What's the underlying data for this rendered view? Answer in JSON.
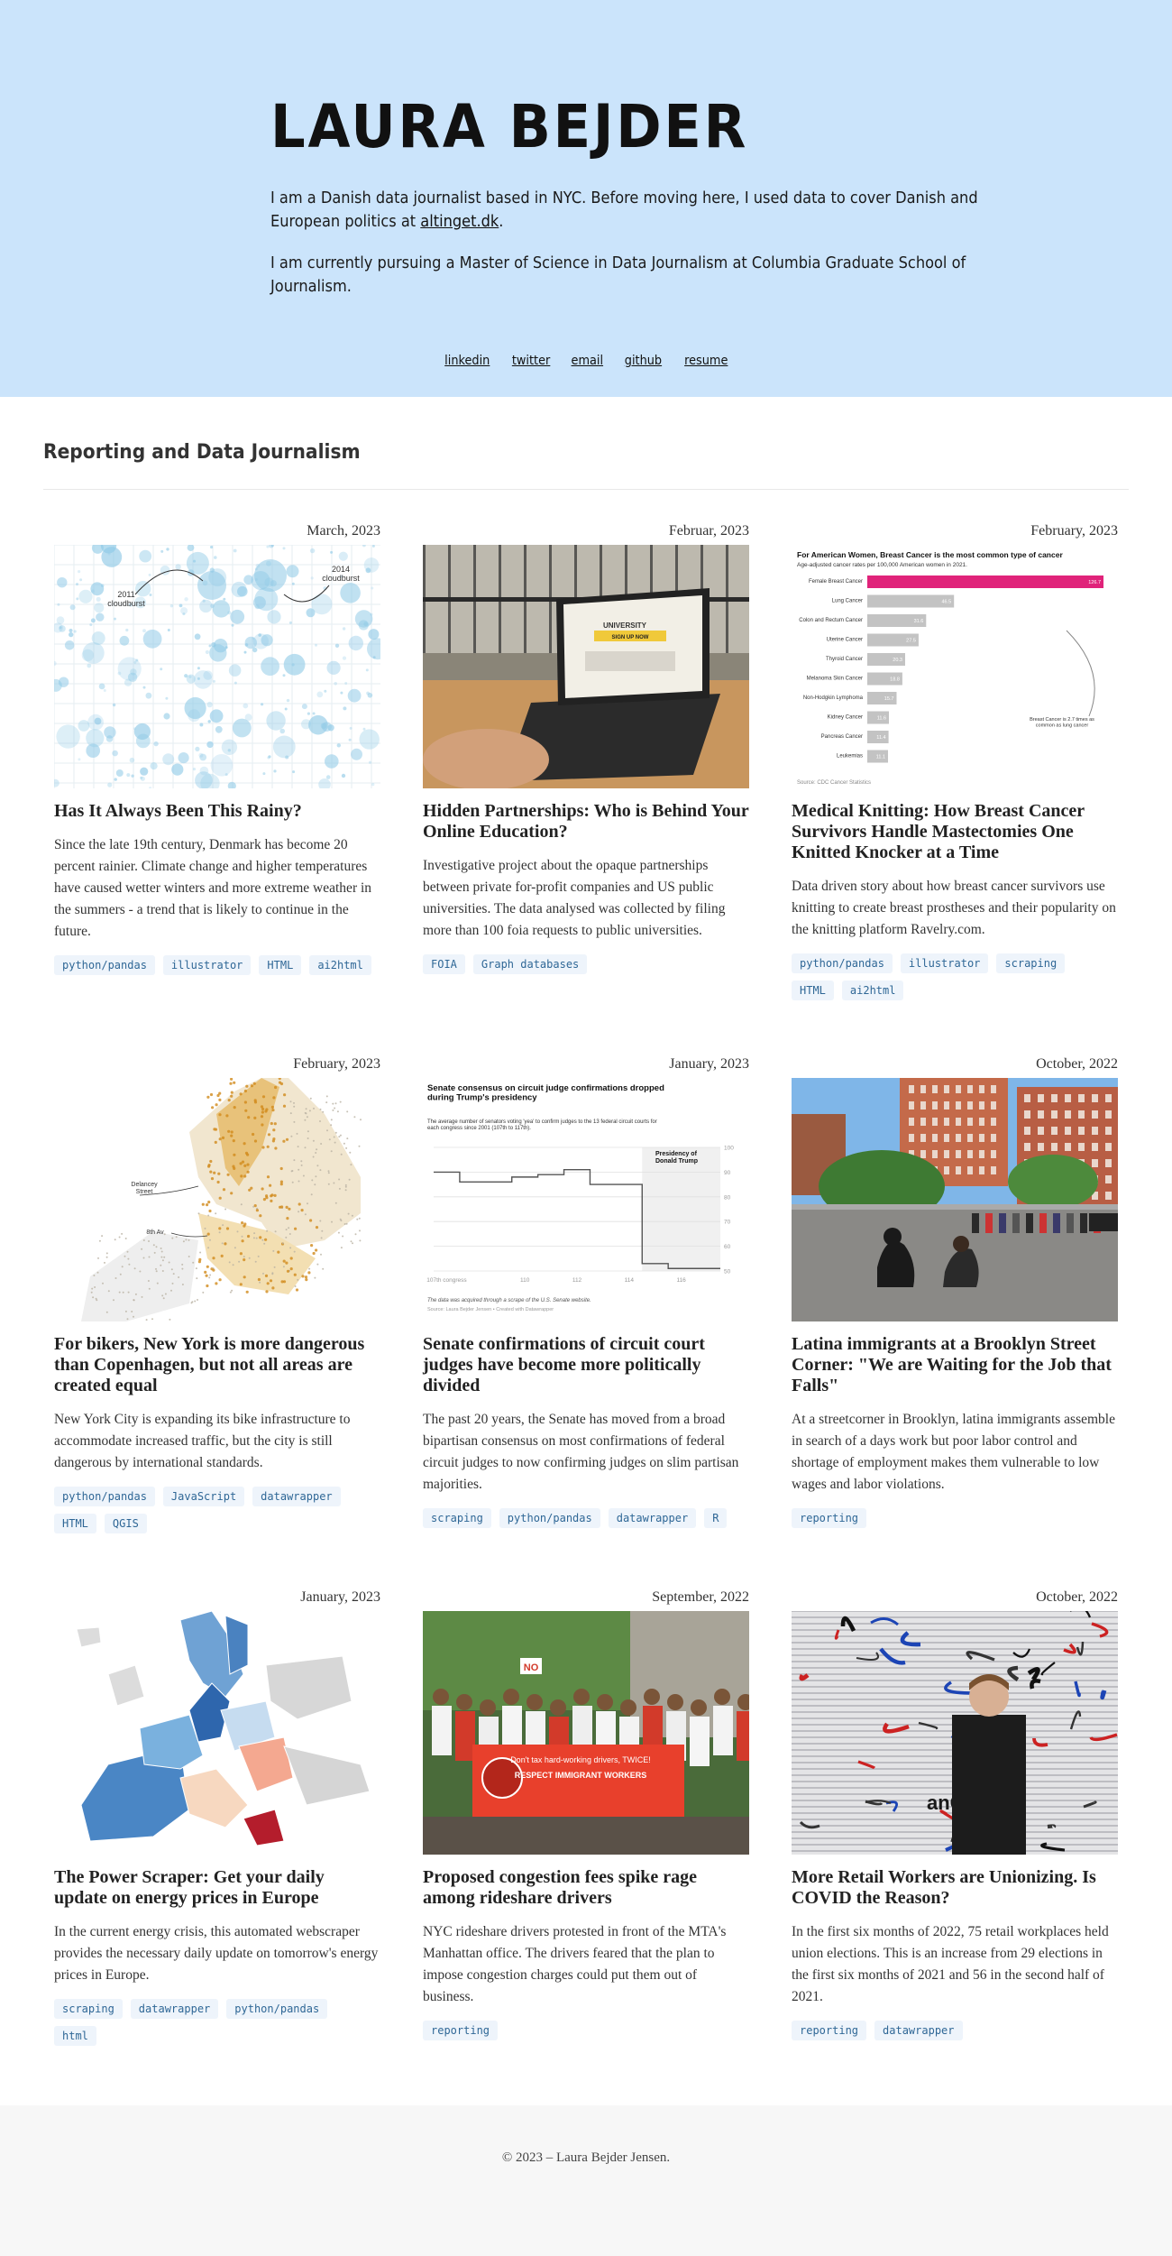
{
  "hero": {
    "name": "LAURA BEJDER",
    "bio1_prefix": "I am a Danish data journalist based in NYC. Before moving here, I used data to cover Danish and European politics at ",
    "bio1_link": "altinget.dk",
    "bio1_suffix": ".",
    "bio2": "I am currently pursuing a Master of Science in Data Journalism at Columbia Graduate School of Journalism."
  },
  "social": [
    "linkedin",
    "twitter",
    "email",
    "github",
    "resume"
  ],
  "section_title": "Reporting and Data Journalism",
  "cards": [
    {
      "date": "March, 2023",
      "title": "Has It Always Been This Rainy?",
      "desc": "Since the late 19th century, Denmark has become 20 percent rainier. Climate change and higher temperatures have caused wetter winters and more extreme weather in the summers - a trend that is likely to continue in the future.",
      "tags": [
        "python/pandas",
        "illustrator",
        "HTML",
        "ai2html"
      ],
      "thumb": "rain",
      "labels": [
        "2011\ncloudburst",
        "2014\ncloudburst"
      ]
    },
    {
      "date": "Februar, 2023",
      "title": "Hidden Partnerships: Who is Behind Your Online Education?",
      "desc": "Investigative project about the opaque partnerships between private for-profit companies and US public universities. The data analysed was collected by filing more than 100 foia requests to public universities.",
      "tags": [
        "FOIA",
        "Graph databases"
      ],
      "thumb": "laptop",
      "labels": [
        "UNIVERSITY",
        "SIGN UP NOW"
      ]
    },
    {
      "date": "February, 2023",
      "title": "Medical Knitting: How Breast Cancer Survivors Handle Mastectomies One Knitted Knocker at a Time",
      "desc": "Data driven story about how breast cancer survivors use knitting to create breast prostheses and their popularity on the knitting platform Ravelry.com.",
      "tags": [
        "python/pandas",
        "illustrator",
        "scraping",
        "HTML",
        "ai2html"
      ],
      "thumb": "bars",
      "labels": [
        "For American Women, Breast Cancer is the most common type of cancer",
        "Age-adjusted cancer rates per 100,000 American women in 2021.",
        "Source: CDC Cancer Statistics",
        "Breast Cancer is 2.7 times as common as lung cancer"
      ],
      "bars": [
        {
          "name": "Female Breast Cancer",
          "value": 126.7,
          "label": "126.7"
        },
        {
          "name": "Lung Cancer",
          "value": 46.5,
          "label": "46.5"
        },
        {
          "name": "Colon and Rectum Cancer",
          "value": 31.6,
          "label": "31.6"
        },
        {
          "name": "Uterine Cancer",
          "value": 27.5,
          "label": "27.5"
        },
        {
          "name": "Thyroid Cancer",
          "value": 20.3,
          "label": "20.3"
        },
        {
          "name": "Melanoma Skin Cancer",
          "value": 18.8,
          "label": "18.8"
        },
        {
          "name": "Non-Hodgkin Lymphoma",
          "value": 15.7,
          "label": "15.7"
        },
        {
          "name": "Kidney Cancer",
          "value": 11.6,
          "label": "11.6"
        },
        {
          "name": "Pancreas Cancer",
          "value": 11.4,
          "label": "11.4"
        },
        {
          "name": "Leukemias",
          "value": 11.1,
          "label": "11.1"
        }
      ]
    },
    {
      "date": "February, 2023",
      "title": "For bikers, New York is more dangerous than Copenhagen, but not all areas are created equal",
      "desc": "New York City is expanding its bike infrastructure to accommodate increased traffic, but the city is still dangerous by international standards.",
      "tags": [
        "python/pandas",
        "JavaScript",
        "datawrapper",
        "HTML",
        "QGIS"
      ],
      "thumb": "nycmap",
      "labels": [
        "Delancey\nStreet",
        "8th Av"
      ]
    },
    {
      "date": "January, 2023",
      "title": "Senate confirmations of circuit court judges have become more politically divided",
      "desc": "The past 20 years, the Senate has moved from a broad bipartisan consensus on most confirmations of federal circuit judges to now confirming judges on slim partisan majorities.",
      "tags": [
        "scraping",
        "python/pandas",
        "datawrapper",
        "R"
      ],
      "thumb": "step",
      "labels": [
        "Senate consensus on circuit judge confirmations dropped during Trump's presidency",
        "The average number of senators voting 'yea' to confirm judges to the 13 federal circuit courts for each congress since 2001 (107th to 117th).",
        "Presidency of Donald Trump",
        "The data was acquired through a scrape of the U.S. Senate website.",
        "Source: Laura Bejder Jensen • Created with Datawrapper"
      ],
      "step": [
        {
          "x": "107th congress",
          "y": 90
        },
        {
          "x": "108",
          "y": 86
        },
        {
          "x": "109",
          "y": 86
        },
        {
          "x": "110",
          "y": 88
        },
        {
          "x": "111",
          "y": 89
        },
        {
          "x": "112",
          "y": 91
        },
        {
          "x": "113",
          "y": 85
        },
        {
          "x": "114",
          "y": 85
        },
        {
          "x": "115",
          "y": 53
        },
        {
          "x": "116",
          "y": 51
        },
        {
          "x": "117",
          "y": 51
        }
      ],
      "step_ticks_x": [
        "107th congress",
        "110",
        "112",
        "114",
        "116"
      ],
      "step_ticks_y": [
        "100",
        "90",
        "80",
        "70",
        "60",
        "50"
      ]
    },
    {
      "date": "October, 2022",
      "title": "Latina immigrants at a Brooklyn Street Corner: \"We are Waiting for the Job that Falls\"",
      "desc": "At a streetcorner in Brooklyn, latina immigrants assemble in search of a days work but poor labor control and shortage of employment makes them vulnerable to low wages and labor violations.",
      "tags": [
        "reporting"
      ],
      "thumb": "street"
    },
    {
      "date": "January, 2023",
      "title": "The Power Scraper: Get your daily update on energy prices in Europe",
      "desc": "In the current energy crisis, this automated webscraper provides the necessary daily update on tomorrow's energy prices in Europe.",
      "tags": [
        "scraping",
        "datawrapper",
        "python/pandas",
        "html"
      ],
      "thumb": "europe"
    },
    {
      "date": "September, 2022",
      "title": "Proposed congestion fees spike rage among rideshare drivers",
      "desc": "NYC rideshare drivers protested in front of the MTA's Manhattan office. The drivers feared that the plan to impose congestion charges could put them out of business.",
      "tags": [
        "reporting"
      ],
      "thumb": "protest",
      "labels": [
        "Don't tax hard-working drivers, TWICE!",
        "RESPECT IMMIGRANT WORKERS",
        "NO"
      ]
    },
    {
      "date": "October, 2022",
      "title": "More Retail Workers are Unionizing. Is COVID the Reason?",
      "desc": "In the first six months of 2022, 75 retail workplaces held union elections. This is an increase from 29 elections in the first six months of 2021 and 56 in the second half of 2021.",
      "tags": [
        "reporting",
        "datawrapper"
      ],
      "thumb": "graffiti",
      "labels": [
        "anOnlyChi"
      ]
    }
  ],
  "footer": "© 2023 – Laura Bejder Jensen."
}
